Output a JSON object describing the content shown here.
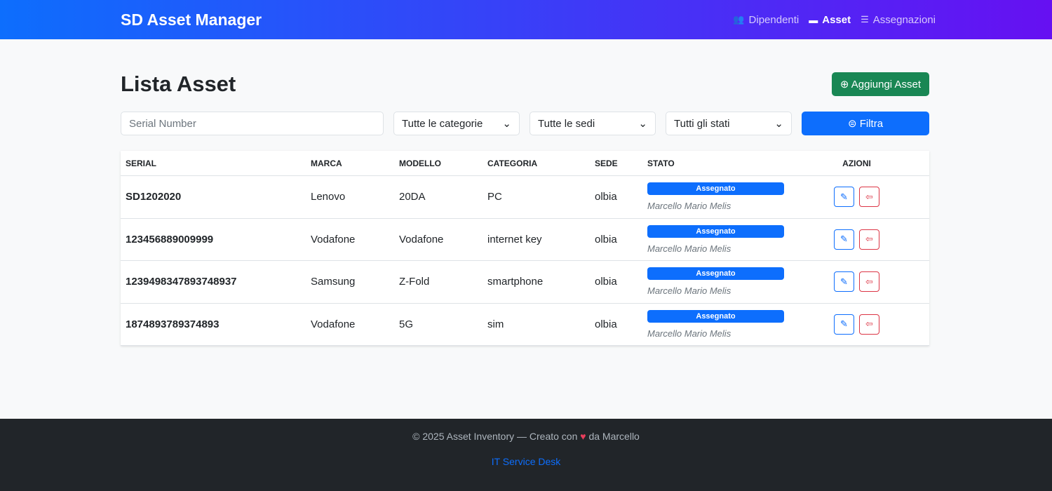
{
  "nav": {
    "brand": "SD Asset Manager",
    "links": [
      {
        "label": "Dipendenti",
        "icon": "users-icon"
      },
      {
        "label": "Asset",
        "icon": "laptop-icon"
      },
      {
        "label": "Assegnazioni",
        "icon": "list-card-icon"
      }
    ]
  },
  "page": {
    "title": "Lista Asset",
    "add_label": "Aggiungi Asset"
  },
  "filters": {
    "serial_placeholder": "Serial Number",
    "category": "Tutte le categorie",
    "site": "Tutte le sedi",
    "status": "Tutti gli stati",
    "filter_label": "Filtra"
  },
  "table": {
    "headers": [
      "SERIAL",
      "MARCA",
      "MODELLO",
      "CATEGORIA",
      "SEDE",
      "STATO",
      "AZIONI"
    ],
    "rows": [
      {
        "serial": "SD1202020",
        "brand": "Lenovo",
        "model": "20DA",
        "category": "PC",
        "site": "olbia",
        "status": "Assegnato",
        "assignee": "Marcello Mario Melis"
      },
      {
        "serial": "123456889009999",
        "brand": "Vodafone",
        "model": "Vodafone",
        "category": "internet key",
        "site": "olbia",
        "status": "Assegnato",
        "assignee": "Marcello Mario Melis"
      },
      {
        "serial": "1239498347893748937",
        "brand": "Samsung",
        "model": "Z-Fold",
        "category": "smartphone",
        "site": "olbia",
        "status": "Assegnato",
        "assignee": "Marcello Mario Melis"
      },
      {
        "serial": "1874893789374893",
        "brand": "Vodafone",
        "model": "5G",
        "category": "sim",
        "site": "olbia",
        "status": "Assegnato",
        "assignee": "Marcello Mario Melis"
      }
    ]
  },
  "footer": {
    "text_before": "© 2025 Asset Inventory — Creato con",
    "heart": "♥",
    "text_after": "da Marcello",
    "link": "IT Service Desk"
  }
}
